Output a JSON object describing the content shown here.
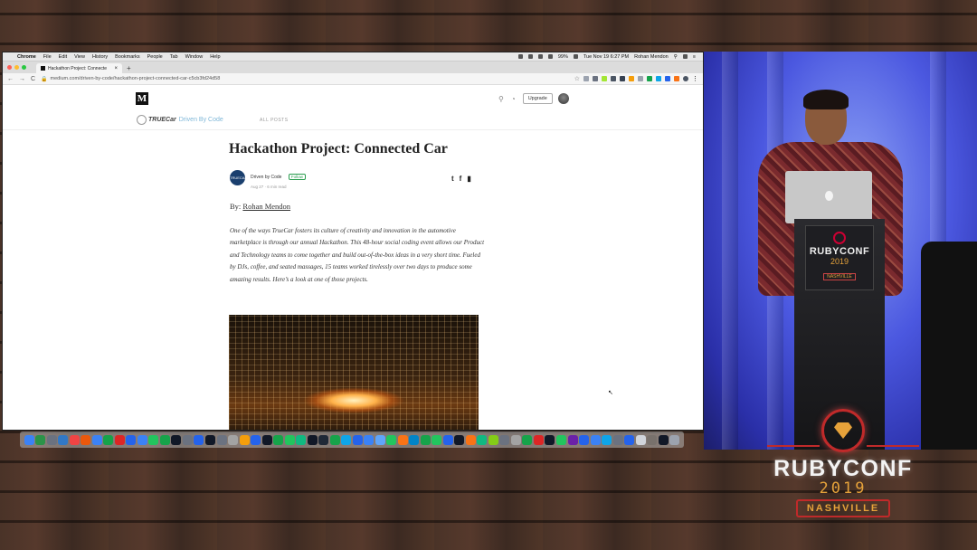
{
  "menubar": {
    "apple": "",
    "app_name": "Chrome",
    "items": [
      "File",
      "Edit",
      "View",
      "History",
      "Bookmarks",
      "People",
      "Tab",
      "Window",
      "Help"
    ],
    "battery": "99%",
    "datetime": "Tue Nov 19  6:27 PM",
    "user": "Rohan Mendon"
  },
  "browser": {
    "tab_title": "Hackathon Project: Connecte",
    "tab_close": "×",
    "new_tab": "+",
    "url": "medium.com/driven-by-code/hackathon-project-connected-car-c5cb3fd24d58",
    "back": "←",
    "forward": "→",
    "reload": "C"
  },
  "medium": {
    "logo": "M",
    "search_icon": "⚲",
    "bell_icon": "🔔",
    "upgrade": "Upgrade",
    "pub_brand": "TRUECar",
    "pub_name": "Driven By Code",
    "all_posts": "ALL POSTS",
    "title": "Hackathon Project: Connected Car",
    "author_badge": "TRUECAR",
    "author": "Driven by Code",
    "follow": "Follow",
    "meta": "Aug 27 · 6 min read",
    "share_twitter": "t",
    "share_facebook": "f",
    "bookmark": "▮",
    "by_prefix": "By: ",
    "by_name": "Rohan Mendon",
    "intro": "One of the ways TrueCar fosters its culture of creativity and innovation in the automotive marketplace is through our annual Hackathon. This 48-hour social coding event allows our Product and Technology teams to come together and build out-of-the-box ideas in a very short time. Fueled by DJs, coffee, and seated massages, 15 teams worked tirelessly over two days to produce some amazing results. Here’s a look at one of those projects."
  },
  "dock_colors": [
    "#3b82f6",
    "#2b9348",
    "#6b7280",
    "#3178c6",
    "#ef4444",
    "#ea580c",
    "#3b82f6",
    "#16a34a",
    "#dc2626",
    "#2563eb",
    "#3b82f6",
    "#22c55e",
    "#16a34a",
    "#111827",
    "#6b7280",
    "#2563eb",
    "#111827",
    "#6b7280",
    "#a3a3a3",
    "#f59e0b",
    "#2563eb",
    "#111827",
    "#16a34a",
    "#22c55e",
    "#10b981",
    "#111827",
    "#1f2937",
    "#16a34a",
    "#0ea5e9",
    "#2563eb",
    "#3b82f6",
    "#60a5fa",
    "#22c55e",
    "#f97316",
    "#0284c7",
    "#16a34a",
    "#22c55e",
    "#2563eb",
    "#111827",
    "#f97316",
    "#10b981",
    "#84cc16",
    "#6b7280",
    "#a3a3a3",
    "#16a34a",
    "#dc2626",
    "#111827",
    "#22c55e",
    "#6b21a8",
    "#2563eb",
    "#3b82f6",
    "#0ea5e9",
    "#6b7280",
    "#2563eb",
    "#d1d5db",
    "#78716c",
    "#111827",
    "#9ca3af"
  ],
  "podium": {
    "name": "RUBYCONF",
    "year": "2019",
    "city": "NASHVILLE"
  },
  "brand": {
    "name": "RUBYCONF",
    "year": "2019",
    "city": "NASHVILLE"
  }
}
